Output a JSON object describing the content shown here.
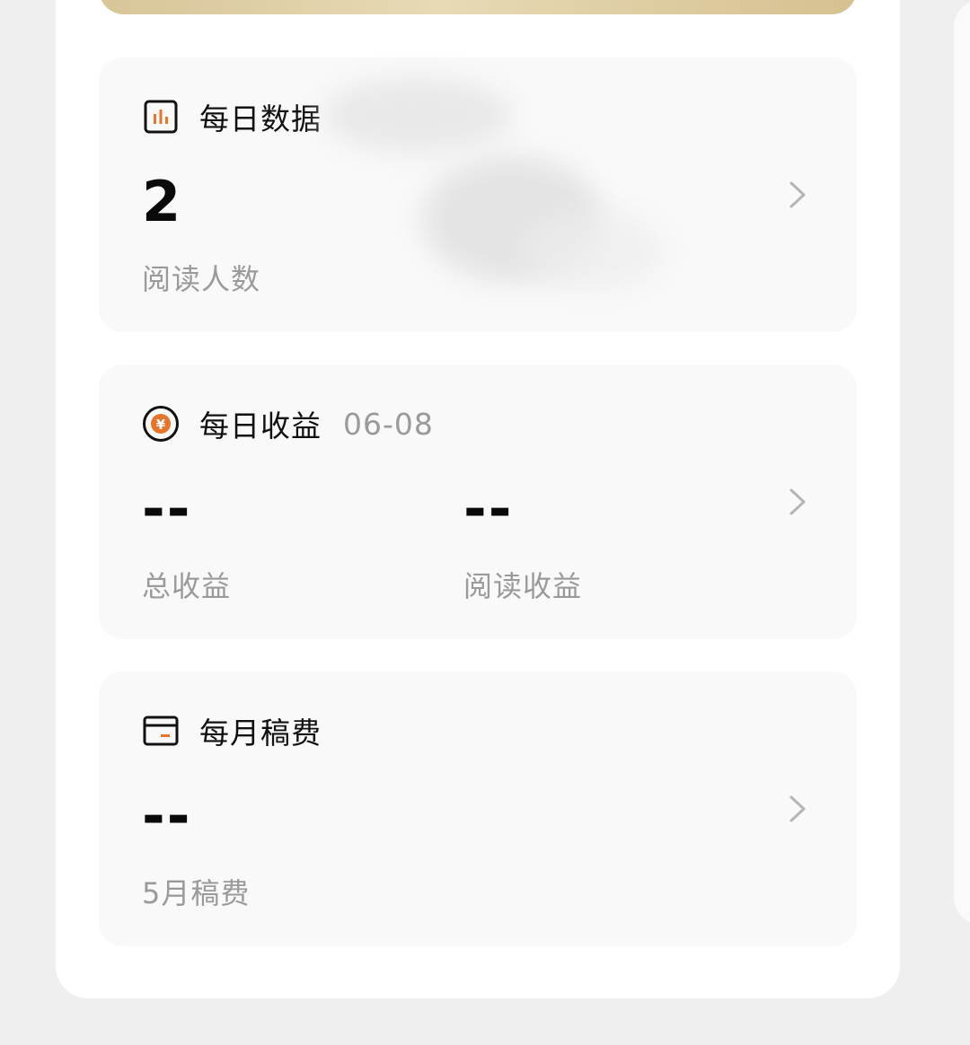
{
  "cards": [
    {
      "title": "每日数据",
      "stats": [
        {
          "value": "2",
          "label": "阅读人数"
        }
      ]
    },
    {
      "title": "每日收益",
      "date": "06-08",
      "stats": [
        {
          "value": "--",
          "label": "总收益"
        },
        {
          "value": "--",
          "label": "阅读收益"
        }
      ]
    },
    {
      "title": "每月稿费",
      "stats": [
        {
          "value": "--",
          "label": "5月稿费"
        }
      ]
    }
  ],
  "icons": {
    "daily_data": "bar-chart-icon",
    "daily_income": "yuan-coin-icon",
    "monthly_fee": "wallet-icon",
    "chevron": "chevron-right-icon"
  },
  "colors": {
    "accent": "#e8742a",
    "banner": "#d8c598"
  }
}
